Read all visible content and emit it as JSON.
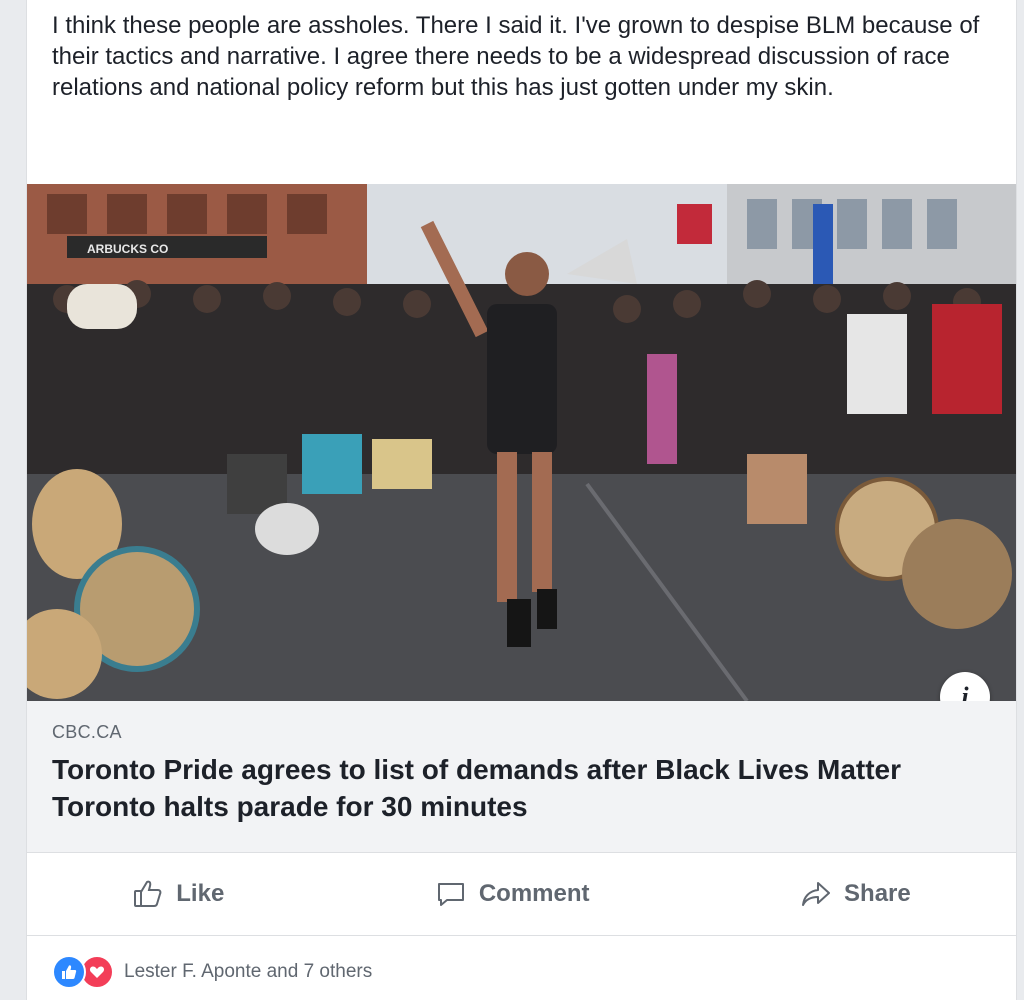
{
  "post": {
    "text": "I think these people are assholes. There I said it. I've grown to despise BLM because of their tactics and narrative. I agree there needs to be a widespread discussion of race relations and national policy reform but this has just gotten under my skin."
  },
  "link_card": {
    "image_sign_text": "ARBUCKS CO",
    "source": "CBC.CA",
    "headline": "Toronto Pride agrees to list of demands after Black Lives Matter Toronto halts parade for 30 minutes",
    "info_label": "i"
  },
  "actions": {
    "like_label": "Like",
    "comment_label": "Comment",
    "share_label": "Share"
  },
  "reactions": {
    "summary": "Lester F. Aponte and 7 others",
    "icons": [
      "like-icon",
      "love-icon"
    ]
  },
  "colors": {
    "like_blue": "#2d88ff",
    "love_red": "#f33e58",
    "secondary_text": "#606770"
  }
}
